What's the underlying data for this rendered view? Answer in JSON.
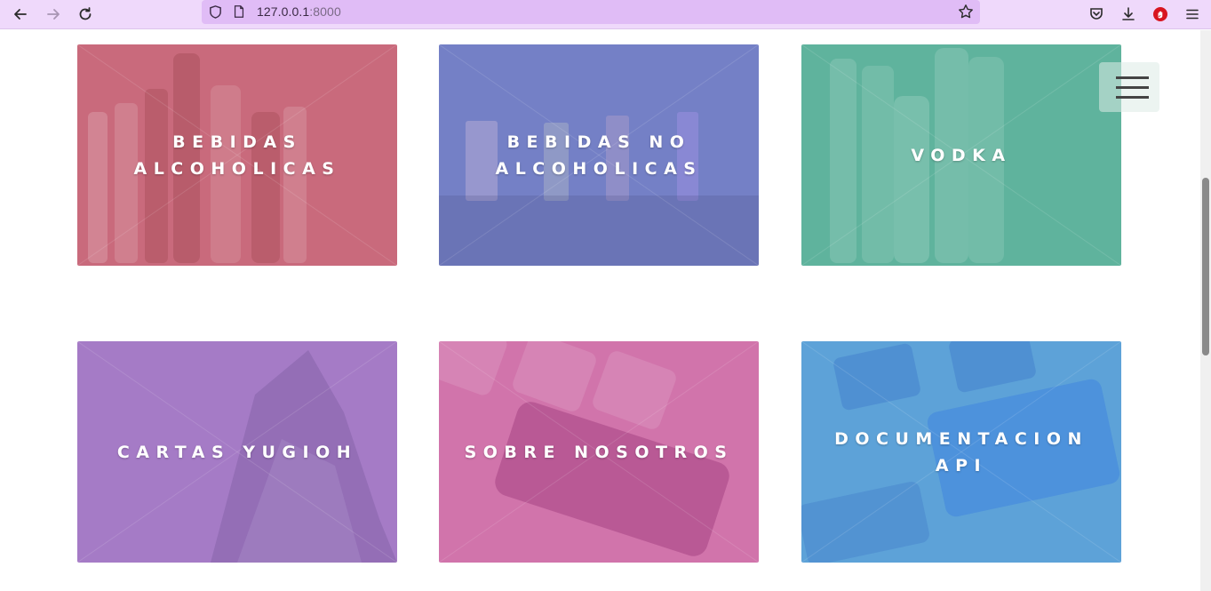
{
  "browser": {
    "url_host": "127.0.0.1",
    "url_port": ":8000",
    "icons": [
      "back-icon",
      "forward-icon",
      "reload-icon",
      "shield-icon",
      "page-icon",
      "bookmark-star-icon",
      "pocket-icon",
      "download-icon",
      "extension-icon",
      "app-menu-icon"
    ]
  },
  "cards": [
    {
      "label": "BEBIDAS ALCOHOLICAS",
      "color": "#c96a7c"
    },
    {
      "label": "BEBIDAS NO ALCOHOLICAS",
      "color": "#7480c6"
    },
    {
      "label": "VODKA",
      "color": "#5fb39d"
    },
    {
      "label": "CARTAS YUGIOH",
      "color": "#a57bc6"
    },
    {
      "label": "SOBRE NOSOTROS",
      "color": "#d174ab"
    },
    {
      "label": "DOCUMENTACION API",
      "color": "#5da2d8"
    }
  ],
  "menu": {
    "icon": "hamburger-icon"
  }
}
